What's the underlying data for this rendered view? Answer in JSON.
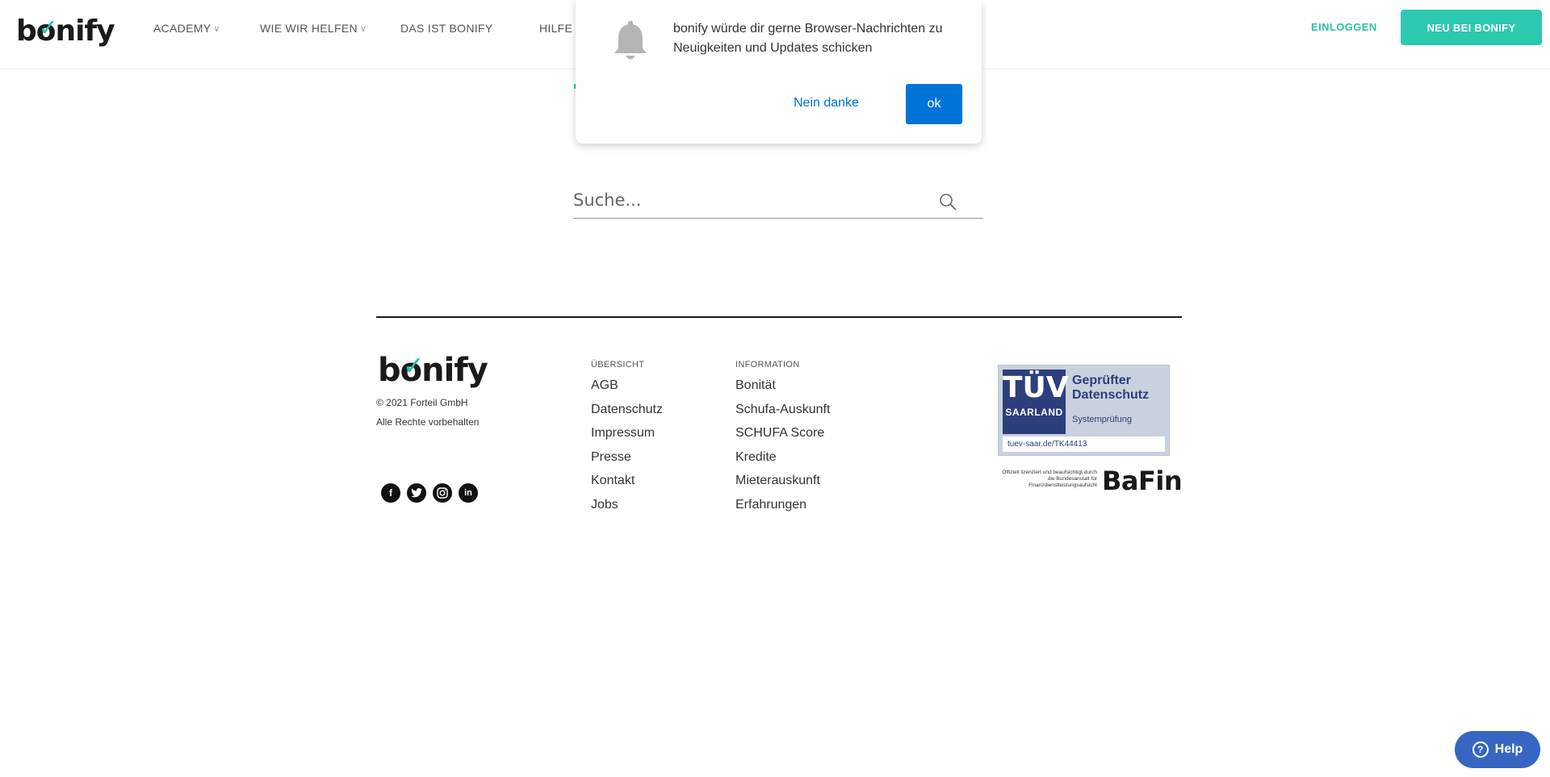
{
  "header": {
    "logo_text": "bonify",
    "nav": [
      {
        "label": "ACADEMY",
        "has_dropdown": true
      },
      {
        "label": "WIE WIR HELFEN",
        "has_dropdown": true
      },
      {
        "label": "DAS IST BONIFY",
        "has_dropdown": false
      },
      {
        "label": "HILFE",
        "has_dropdown": false
      }
    ],
    "login_label": "EINLOGGEN",
    "signup_label": "NEU BEI BONIFY"
  },
  "notification": {
    "icon": "bell-icon",
    "message": "bonify würde dir gerne Browser-Nachrichten zu Neuigkeiten und Updates schicken",
    "decline_label": "Nein danke",
    "accept_label": "ok"
  },
  "search": {
    "placeholder": "Suche...",
    "icon": "search-icon"
  },
  "footer": {
    "logo_text": "bonify",
    "copyright": "© 2021 Forteil GmbH",
    "rights": "Alle Rechte vorbehalten",
    "socials": [
      "facebook-icon",
      "twitter-icon",
      "instagram-icon",
      "linkedin-icon"
    ],
    "columns": [
      {
        "heading": "ÜBERSICHT",
        "links": [
          "AGB",
          "Datenschutz",
          "Impressum",
          "Presse",
          "Kontakt",
          "Jobs"
        ]
      },
      {
        "heading": "INFORMATION",
        "links": [
          "Bonität",
          "Schufa-Auskunft",
          "SCHUFA Score",
          "Kredite",
          "Mieterauskunft",
          "Erfahrungen"
        ]
      }
    ],
    "tuv": {
      "brand": "TÜV",
      "region": "SAARLAND",
      "title_line1": "Geprüfter",
      "title_line2": "Datenschutz",
      "subtitle": "Systemprüfung",
      "url": "tuev-saar.de/TK44413"
    },
    "bafin": {
      "note": "Offiziell lizenziert und beaufsichtigt durch die Bundesanstalt für Finanzdienstleistungsaufsicht",
      "label": "BaFin"
    }
  },
  "help": {
    "label": "Help"
  },
  "colors": {
    "brand_teal": "#2dc8b0",
    "notification_blue": "#0073d8",
    "help_blue": "#3766c2",
    "tuv_navy": "#2c3e7d"
  }
}
